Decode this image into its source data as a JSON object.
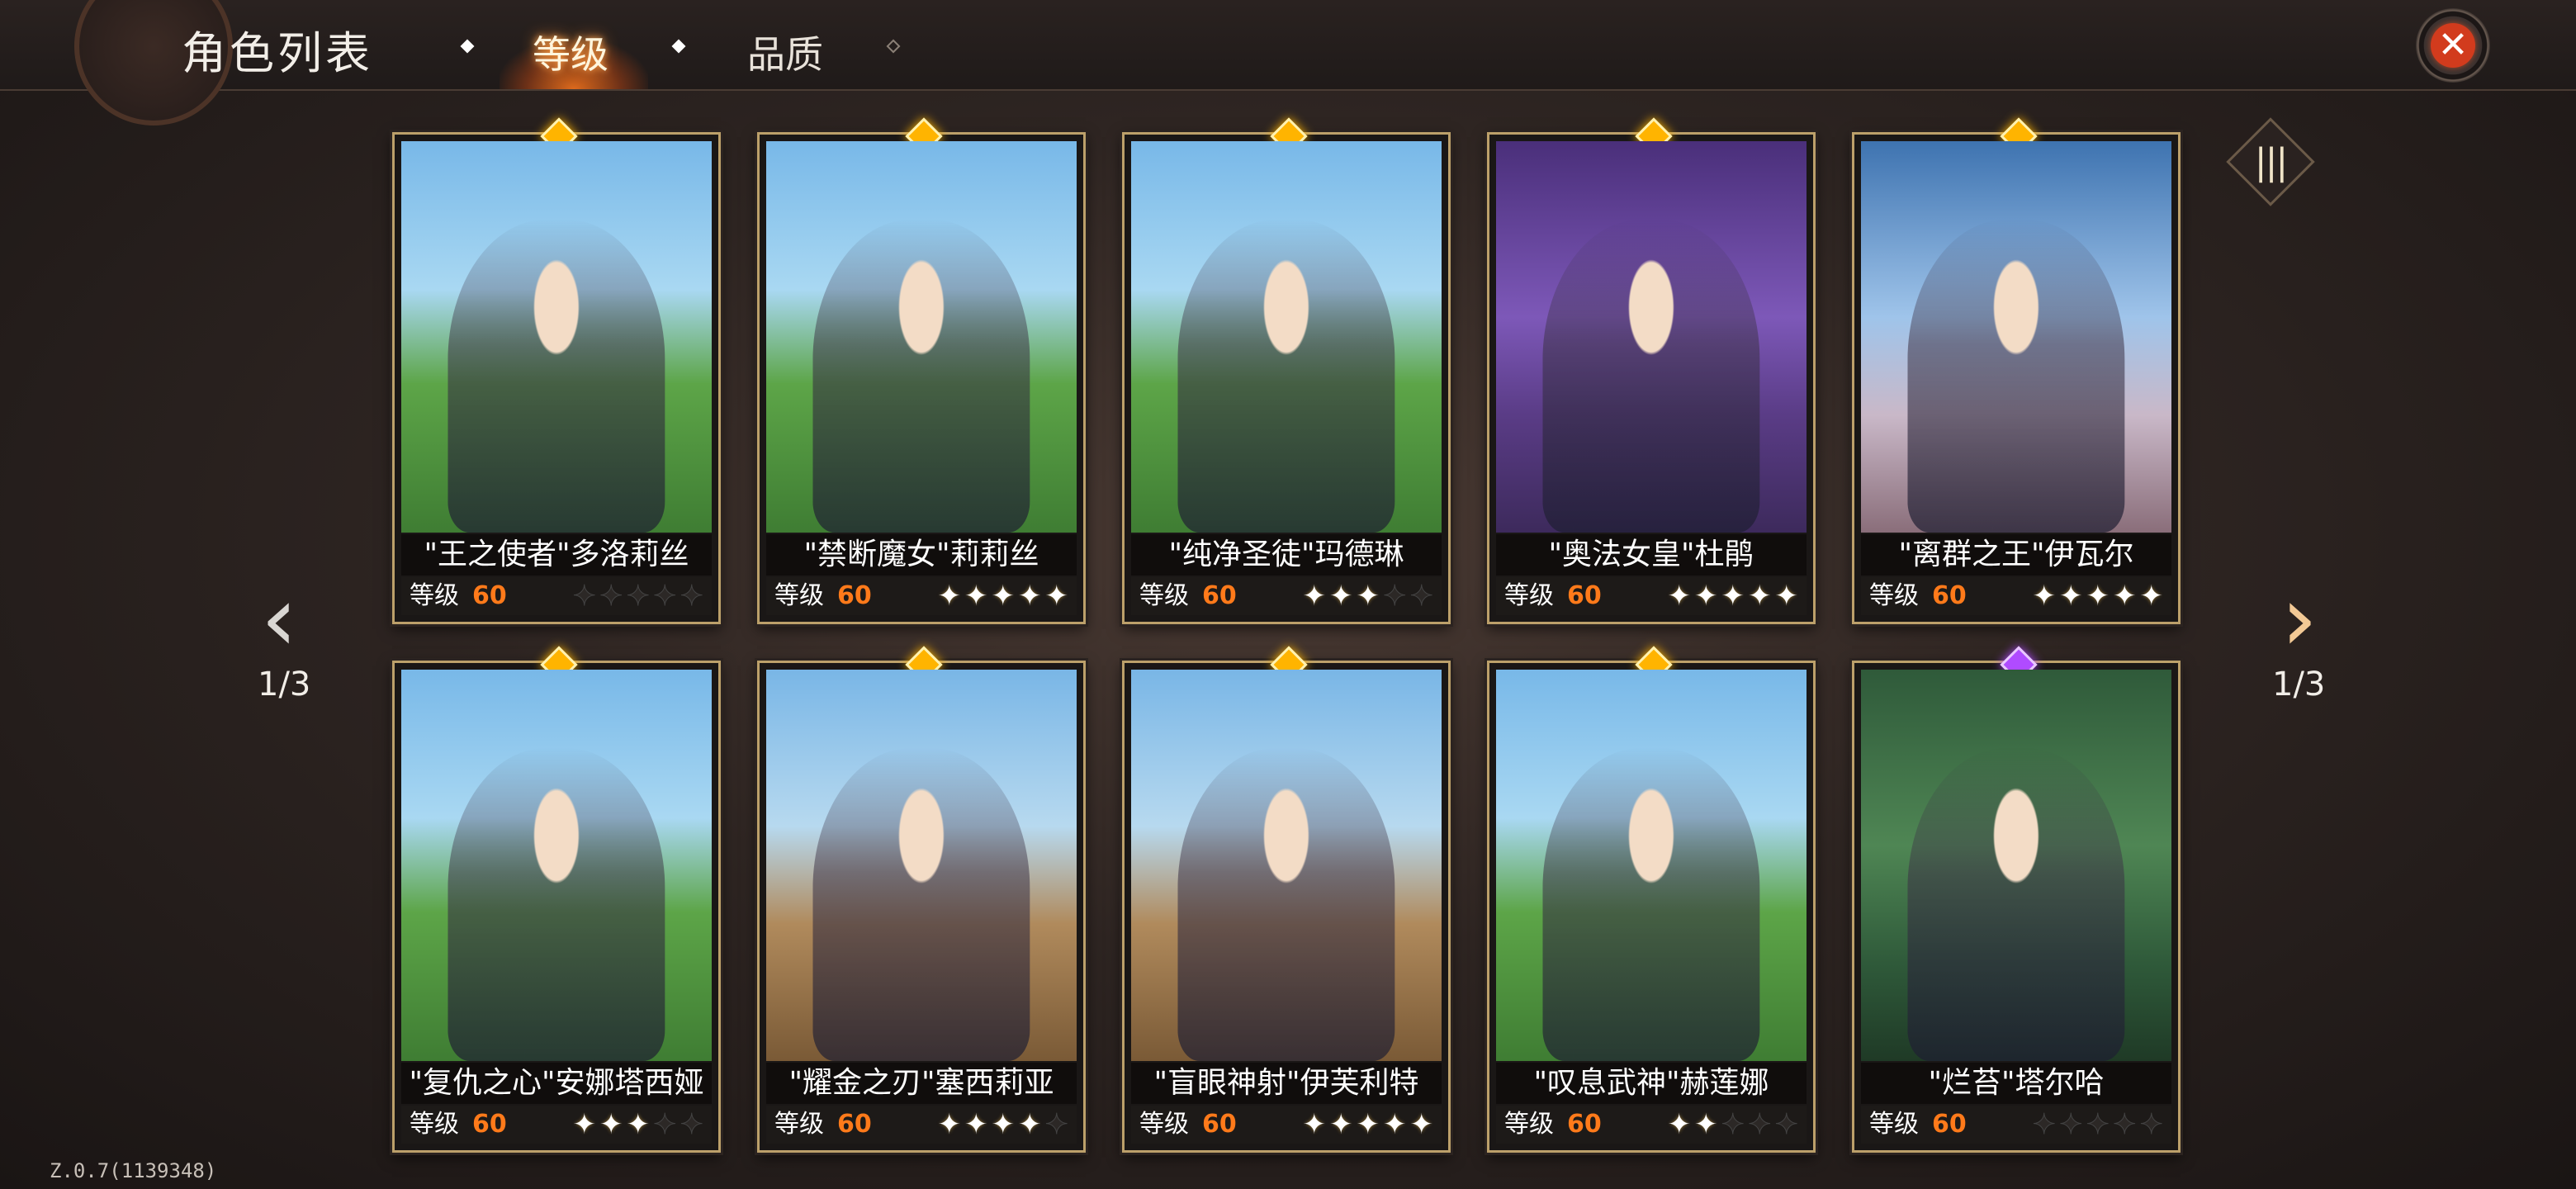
{
  "header": {
    "title": "角色列表",
    "tabs": [
      {
        "label": "等级",
        "active": true
      },
      {
        "label": "品质",
        "active": false
      }
    ]
  },
  "pagination": {
    "left_label": "1/3",
    "right_label": "1/3"
  },
  "level_label": "等级",
  "cards": [
    {
      "name": "\"王之使者\"多洛莉丝",
      "level": "60",
      "stars": 0,
      "max_stars": 5,
      "gem": "gold",
      "bg": "plains"
    },
    {
      "name": "\"禁断魔女\"莉莉丝",
      "level": "60",
      "stars": 5,
      "max_stars": 5,
      "gem": "gold",
      "bg": "plains"
    },
    {
      "name": "\"纯净圣徒\"玛德琳",
      "level": "60",
      "stars": 3,
      "max_stars": 5,
      "gem": "gold",
      "bg": "plains"
    },
    {
      "name": "\"奥法女皇\"杜鹃",
      "level": "60",
      "stars": 5,
      "max_stars": 5,
      "gem": "gold",
      "bg": "purple"
    },
    {
      "name": "\"离群之王\"伊瓦尔",
      "level": "60",
      "stars": 5,
      "max_stars": 5,
      "gem": "gold",
      "bg": "blue"
    },
    {
      "name": "\"复仇之心\"安娜塔西娅",
      "level": "60",
      "stars": 3,
      "max_stars": 5,
      "gem": "gold",
      "bg": "plains"
    },
    {
      "name": "\"耀金之刃\"塞西莉亚",
      "level": "60",
      "stars": 4,
      "max_stars": 5,
      "gem": "gold",
      "bg": "desert"
    },
    {
      "name": "\"盲眼神射\"伊芙利特",
      "level": "60",
      "stars": 5,
      "max_stars": 5,
      "gem": "gold",
      "bg": "desert"
    },
    {
      "name": "\"叹息武神\"赫莲娜",
      "level": "60",
      "stars": 2,
      "max_stars": 5,
      "gem": "gold",
      "bg": "plains"
    },
    {
      "name": "\"烂苔\"塔尔哈",
      "level": "60",
      "stars": 0,
      "max_stars": 5,
      "gem": "purple",
      "bg": "jungle"
    }
  ],
  "version": "Z.0.7(1139348)",
  "icons": {
    "close": "close-icon",
    "prev": "chevron-left-icon",
    "next": "chevron-right-icon",
    "view_toggle": "bars-icon",
    "star": "star-icon"
  },
  "colors": {
    "accent_orange": "#ff7a1a",
    "close_red": "#d23b1d",
    "gem_gold": "#ffb400",
    "gem_purple": "#b04bff"
  }
}
